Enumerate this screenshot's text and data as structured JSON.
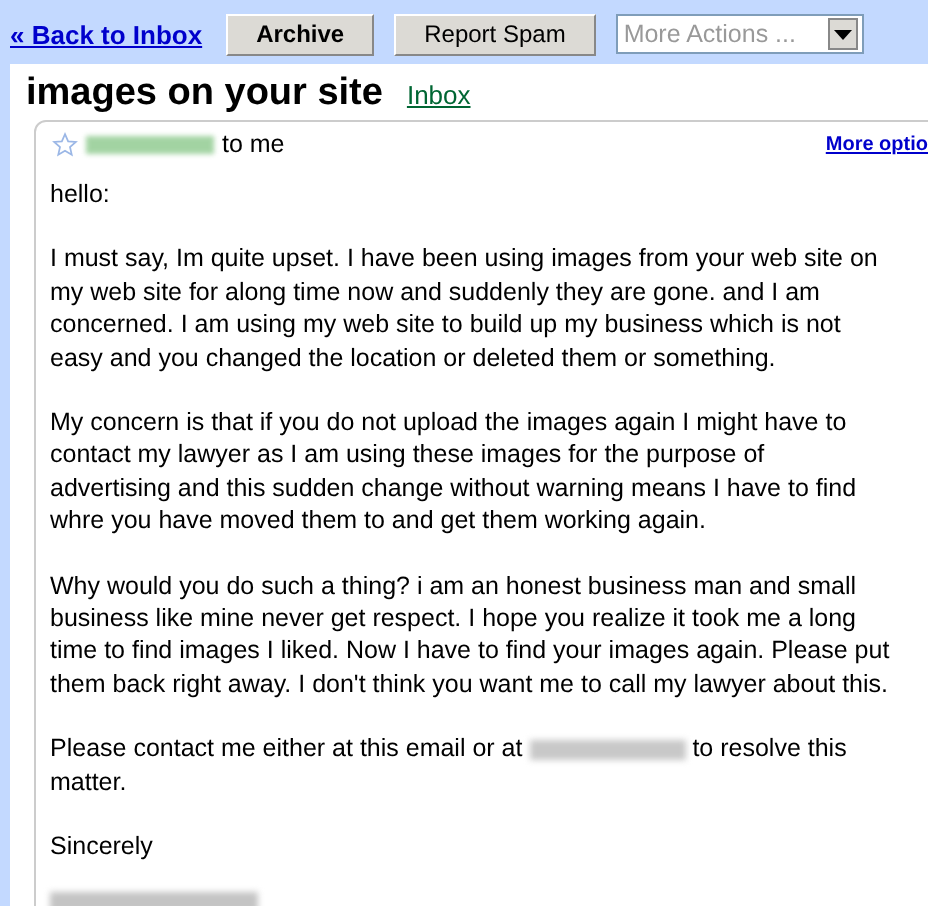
{
  "toolbar": {
    "back_link": "« Back to Inbox",
    "buttons": [
      "Archive",
      "Report Spam"
    ],
    "more_actions": {
      "value": "More Actions ..."
    }
  },
  "subject": {
    "title": "images on your site",
    "label": "Inbox"
  },
  "message": {
    "starred": false,
    "recipient": "to me",
    "more_options": "More optio",
    "greeting": "hello:",
    "paragraphs": [
      {
        "kind": "plain",
        "text": "I must say, Im quite upset. I have been using images from your web site on my web site for along time now and suddenly they are gone. and I am concerned. I am using my web site to build up my business which is not easy and you changed the location or deleted them or something."
      },
      {
        "kind": "plain",
        "text": "My concern is that if you do not upload the images again I might have to contact my lawyer as I am using these images for the purpose of advertising and this sudden change without warning means I have to find whre you have moved them to and get them working again."
      },
      {
        "kind": "plain",
        "text": "Why would you do such a thing? i am an honest business man and small business like mine never get respect. I hope you realize it took me a long time to find images I liked. Now I have to find your images again. Please put them back right away. I don't think you want me to call my lawyer about this."
      },
      {
        "kind": "redacted",
        "before": "Please contact me either at this email or at",
        "after": [
          "to resolve this",
          "matter."
        ]
      }
    ],
    "closing": "Sincerely"
  }
}
